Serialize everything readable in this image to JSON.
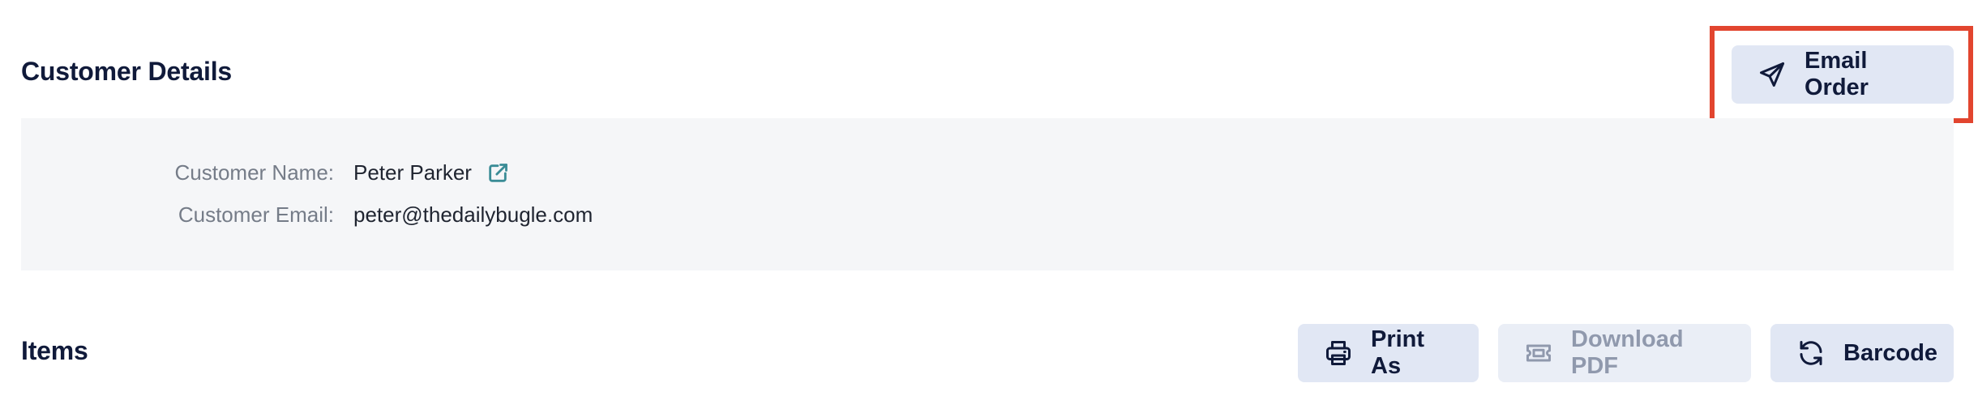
{
  "customer_section": {
    "title": "Customer Details",
    "email_order_label": "Email Order",
    "email_order_icon": "paper-plane-icon",
    "highlight_color": "#e2452f",
    "fields": {
      "name_label": "Customer Name:",
      "name_value": "Peter Parker",
      "name_link_icon": "external-link-icon",
      "email_label": "Customer Email:",
      "email_value": "peter@thedailybugle.com"
    }
  },
  "items_section": {
    "title": "Items",
    "buttons": {
      "print_as": {
        "label": "Print As",
        "icon": "printer-icon",
        "disabled": false
      },
      "download_pdf": {
        "label": "Download PDF",
        "icon": "ticket-icon",
        "disabled": true
      },
      "barcode": {
        "label": "Barcode",
        "icon": "refresh-icon",
        "disabled": false
      }
    }
  },
  "colors": {
    "button_bg": "#e1e7f4",
    "link": "#3a8c96",
    "panel_bg": "#f5f6f8",
    "heading": "#101a3a"
  }
}
